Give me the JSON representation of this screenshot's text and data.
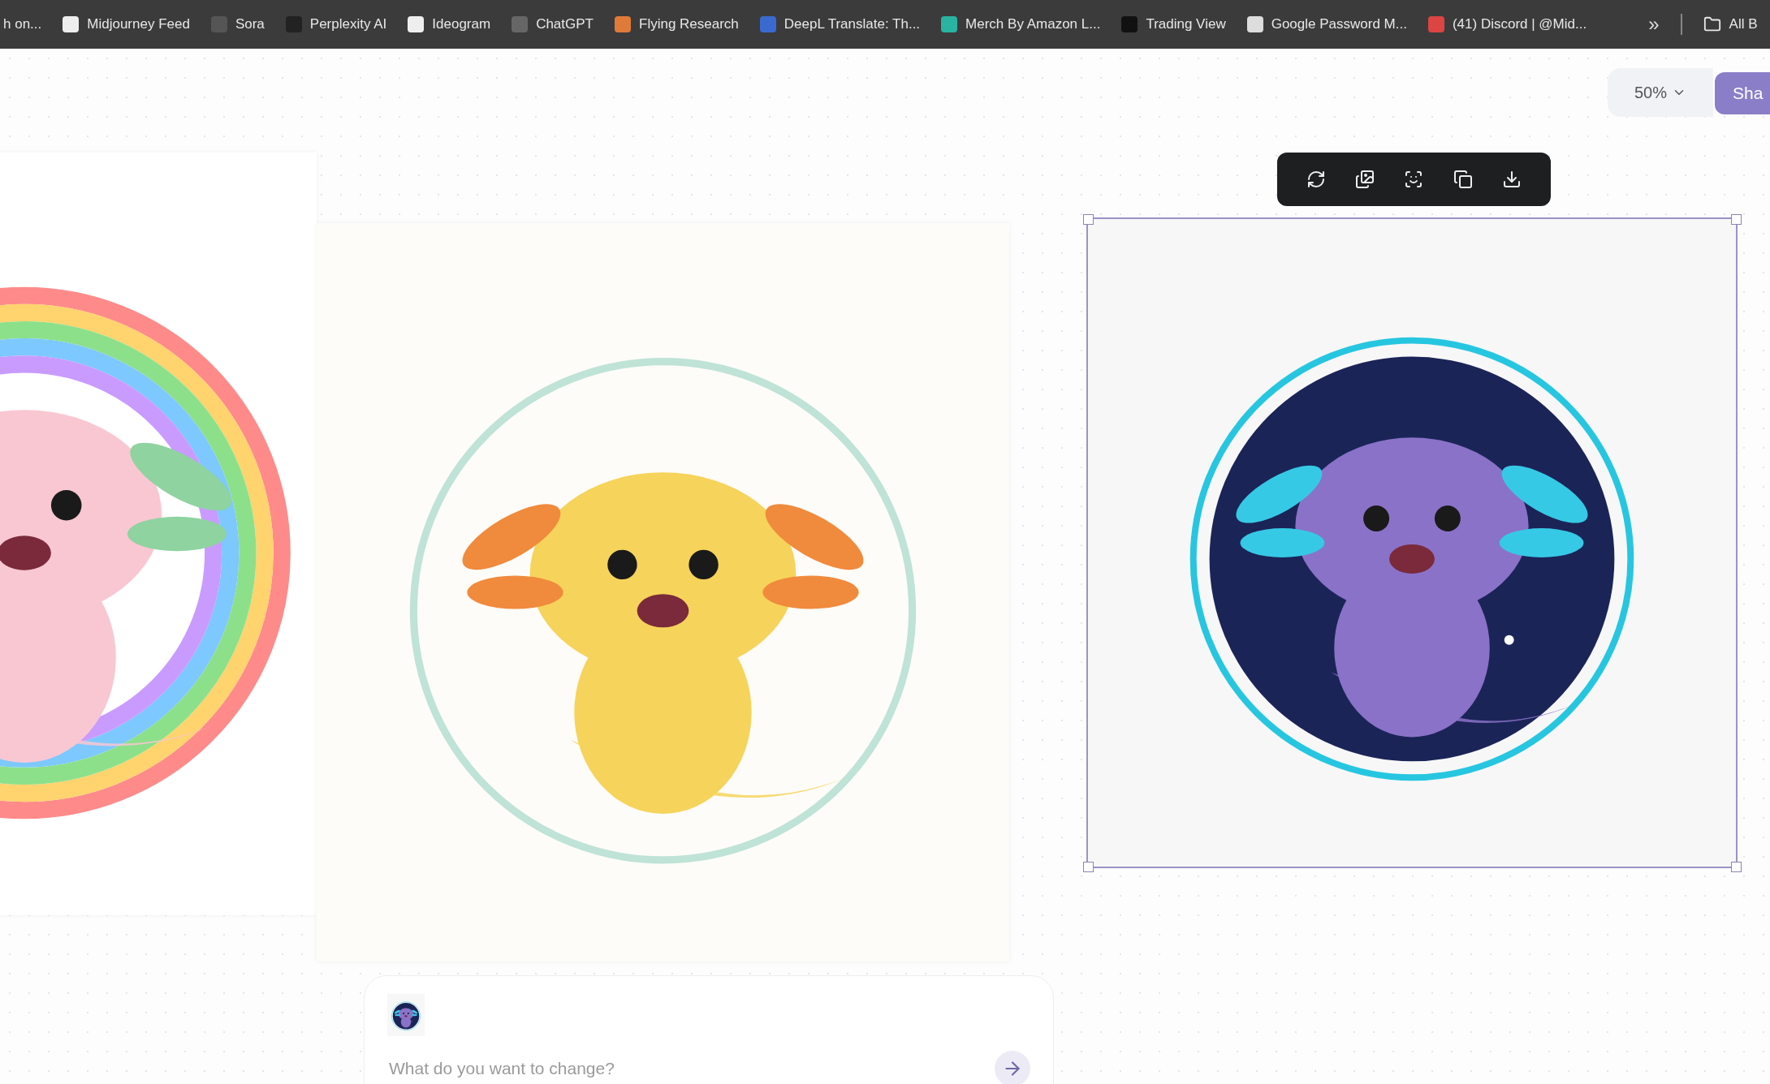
{
  "bookmarks_bar": {
    "items": [
      {
        "label": "h on..."
      },
      {
        "label": "Midjourney Feed"
      },
      {
        "label": "Sora"
      },
      {
        "label": "Perplexity AI"
      },
      {
        "label": "Ideogram"
      },
      {
        "label": "ChatGPT"
      },
      {
        "label": "Flying Research"
      },
      {
        "label": "DeepL Translate: Th..."
      },
      {
        "label": "Merch By Amazon L..."
      },
      {
        "label": "Trading View"
      },
      {
        "label": "Google Password M..."
      },
      {
        "label": "(41) Discord | @Mid..."
      }
    ],
    "overflow": "»",
    "folder": "All B"
  },
  "top_controls": {
    "zoom": "50%",
    "share": "Sha"
  },
  "canvas": {
    "images": [
      {
        "kind": "picture",
        "selected": false
      },
      {
        "kind": "picture",
        "selected": false
      },
      {
        "kind": "picture",
        "selected": true
      }
    ]
  },
  "prompt": {
    "placeholder": "What do you want to change?"
  }
}
